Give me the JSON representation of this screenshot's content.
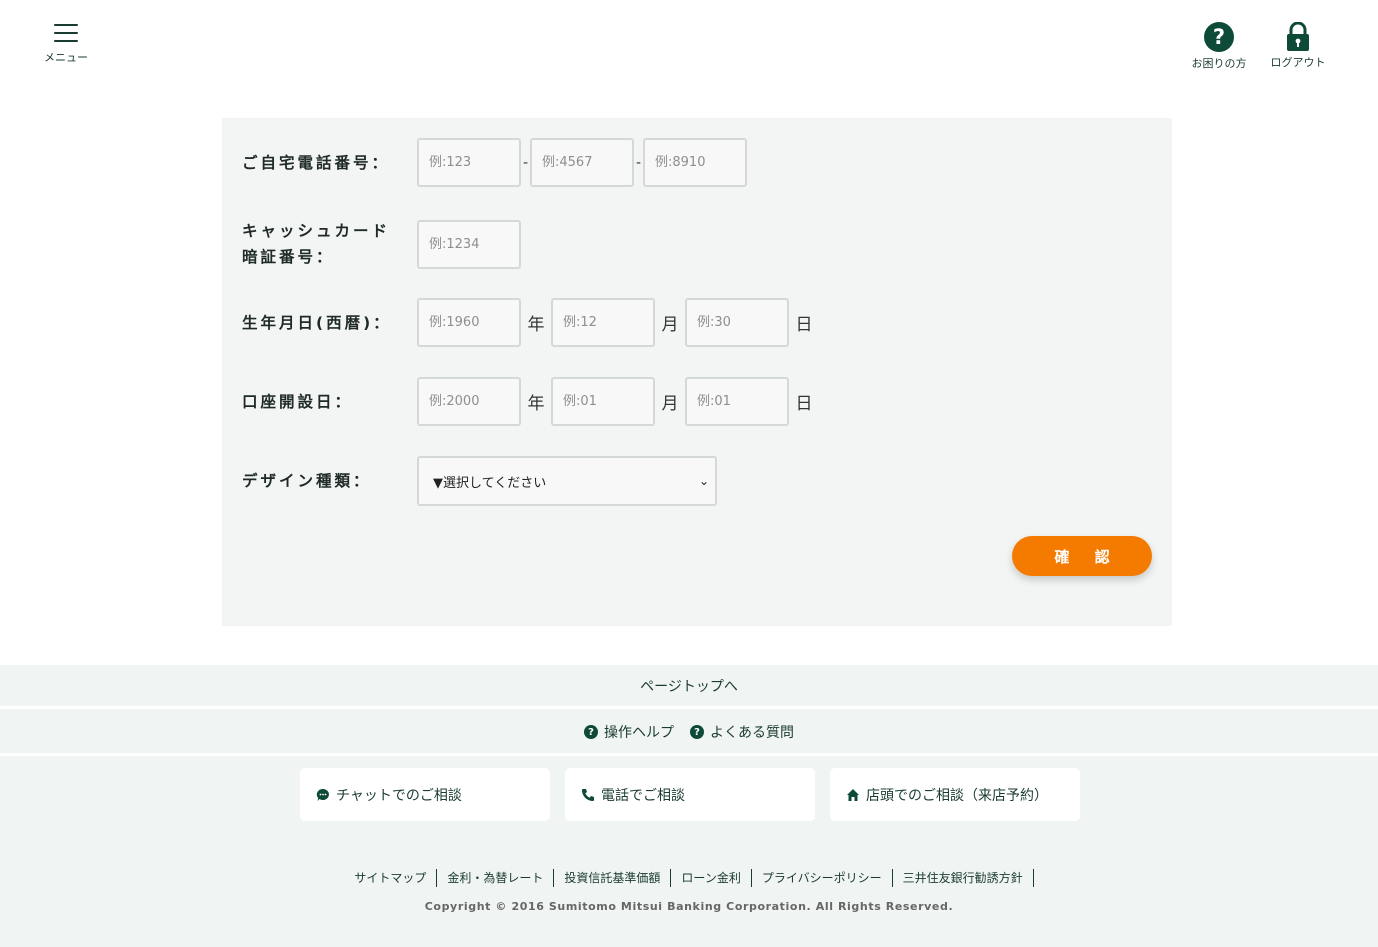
{
  "header": {
    "menu_label": "メニュー",
    "help_label": "お困りの方",
    "logout_label": "ログアウト"
  },
  "form": {
    "phone": {
      "label": "ご自宅電話番号：",
      "placeholders": [
        "例:123",
        "例:4567",
        "例:8910"
      ],
      "separator": "-"
    },
    "pin": {
      "label_line1": "キャッシュカード",
      "label_line2": "暗証番号：",
      "placeholder": "例:1234"
    },
    "birthdate": {
      "label": "生年月日(西暦)：",
      "placeholders": [
        "例:1960",
        "例:12",
        "例:30"
      ],
      "units": [
        "年",
        "月",
        "日"
      ]
    },
    "account_open_date": {
      "label": "口座開設日：",
      "placeholders": [
        "例:2000",
        "例:01",
        "例:01"
      ],
      "units": [
        "年",
        "月",
        "日"
      ]
    },
    "design": {
      "label": "デザイン種類：",
      "selected": "▼選択してください"
    },
    "confirm_label": "確 認"
  },
  "footer": {
    "page_top": "ページトップへ",
    "help_links": [
      "操作ヘルプ",
      "よくある質問"
    ],
    "consult": [
      "チャットでのご相談",
      "電話でご相談",
      "店頭でのご相談（来店予約）"
    ],
    "links": [
      "サイトマップ",
      "金利・為替レート",
      "投資信託基準価額",
      "ローン金利",
      "プライバシーポリシー",
      "三井住友銀行勧誘方針"
    ],
    "copyright": "Copyright © 2016 Sumitomo Mitsui Banking Corporation. All Rights Reserved."
  },
  "colors": {
    "brand_green": "#0d4a37",
    "accent_orange": "#f47a00",
    "panel_bg": "#f2f5f3"
  }
}
